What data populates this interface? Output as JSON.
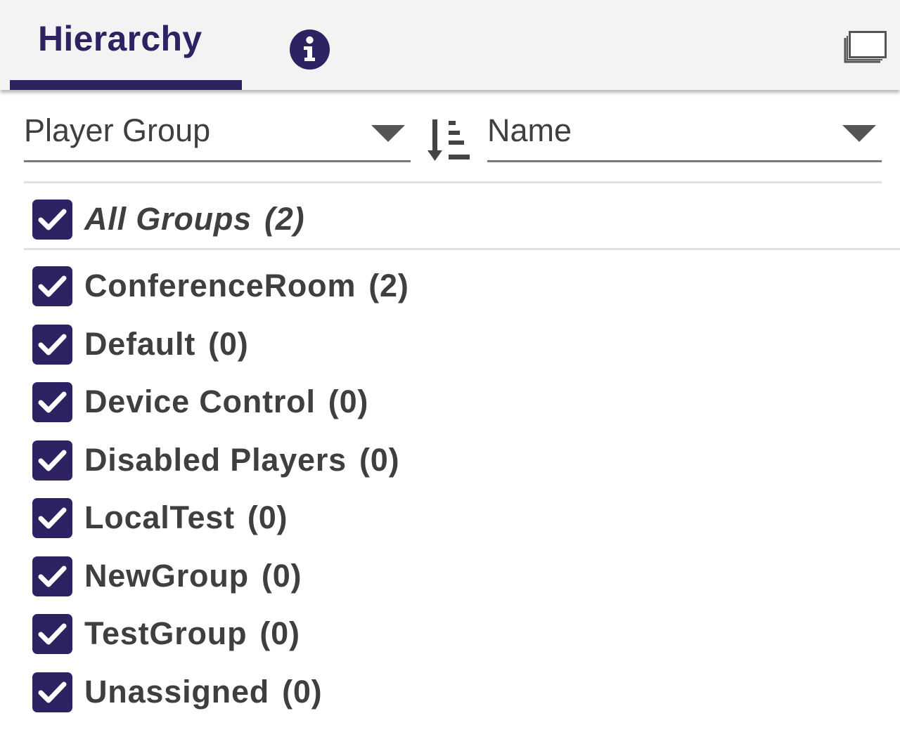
{
  "header": {
    "tab_label": "Hierarchy",
    "info_icon": "info-icon",
    "window_icon": "window-icon"
  },
  "controls": {
    "group_by": "Player Group",
    "sort_by": "Name",
    "sort_icon": "sort-ascending-icon"
  },
  "all_groups": {
    "label": "All Groups",
    "count": "(2)",
    "checked": true
  },
  "groups": [
    {
      "label": "ConferenceRoom",
      "count": "(2)",
      "checked": true
    },
    {
      "label": "Default",
      "count": "(0)",
      "checked": true
    },
    {
      "label": "Device Control",
      "count": "(0)",
      "checked": true
    },
    {
      "label": "Disabled Players",
      "count": "(0)",
      "checked": true
    },
    {
      "label": "LocalTest",
      "count": "(0)",
      "checked": true
    },
    {
      "label": "NewGroup",
      "count": "(0)",
      "checked": true
    },
    {
      "label": "TestGroup",
      "count": "(0)",
      "checked": true
    },
    {
      "label": "Unassigned",
      "count": "(0)",
      "checked": true
    }
  ],
  "colors": {
    "accent": "#2e2263",
    "text": "#3f3f3f",
    "header_bg": "#f3f3f3"
  }
}
